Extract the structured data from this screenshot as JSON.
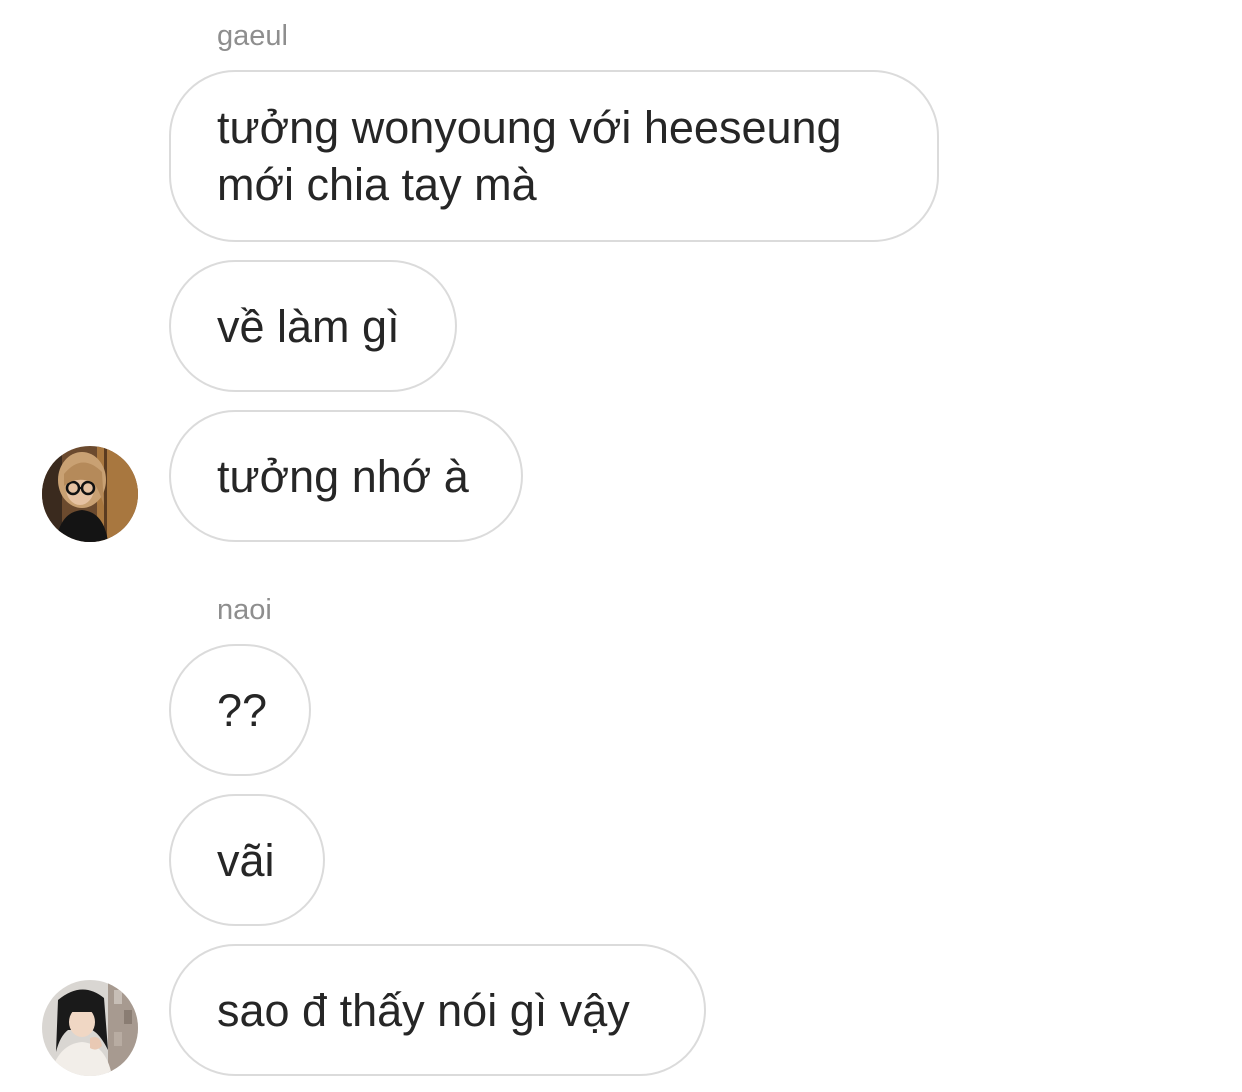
{
  "conversation": {
    "groups": [
      {
        "sender": "gaeul",
        "messages": [
          "tưởng wonyoung với heeseung\nmới chia tay mà",
          "về làm gì",
          "tưởng nhớ à"
        ],
        "avatar": "profile-photo-gaeul"
      },
      {
        "sender": "naoi",
        "messages": [
          "??",
          "vãi",
          "sao đ thấy nói gì vậy"
        ],
        "avatar": "profile-photo-naoi"
      }
    ]
  },
  "colors": {
    "bubble_border": "#dbdbdb",
    "message_text": "#262626",
    "sender_name": "#8e8e8e",
    "background": "#ffffff"
  }
}
